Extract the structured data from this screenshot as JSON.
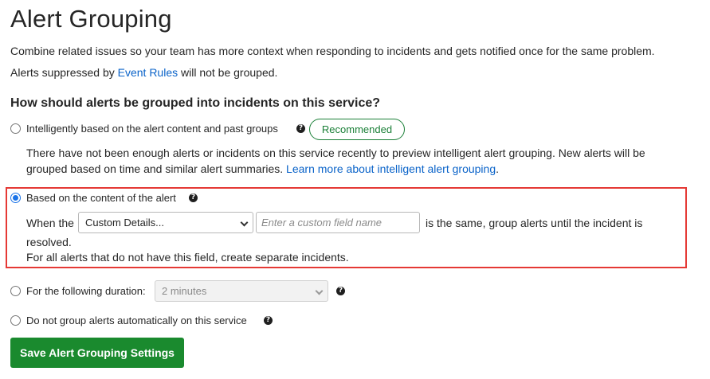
{
  "page": {
    "title": "Alert Grouping",
    "intro": "Combine related issues so your team has more context when responding to incidents and gets notified once for the same problem.",
    "suppressed_prefix": "Alerts suppressed by ",
    "suppressed_link": "Event Rules",
    "suppressed_suffix": " will not be grouped.",
    "question": "How should alerts be grouped into incidents on this service?"
  },
  "options": {
    "intelligent": {
      "label": "Intelligently based on the alert content and past groups",
      "badge": "Recommended",
      "description": "There have not been enough alerts or incidents on this service recently to preview intelligent alert grouping. New alerts will be grouped based on time and similar alert summaries. ",
      "learn_more": "Learn more about intelligent alert grouping",
      "after_link": ".",
      "selected": false
    },
    "content": {
      "label": "Based on the content of the alert",
      "selected": true,
      "when_the": "When the",
      "field_select_value": "Custom Details...",
      "field_input_placeholder": "Enter a custom field name",
      "same_text_line1": "is the same, group alerts until the incident is",
      "same_text_line2": "resolved.",
      "no_field_text": "For all alerts that do not have this field, create separate incidents."
    },
    "duration": {
      "label": "For the following duration:",
      "select_value": "2 minutes",
      "selected": false
    },
    "none": {
      "label": "Do not group alerts automatically on this service",
      "selected": false
    }
  },
  "help_glyph": "?",
  "save_button": "Save Alert Grouping Settings",
  "colors": {
    "link": "#0a63c9",
    "recommended": "#1a7f37",
    "save": "#1a8a2e",
    "highlight": "#e53935",
    "radio_checked": "#1a73e8"
  }
}
